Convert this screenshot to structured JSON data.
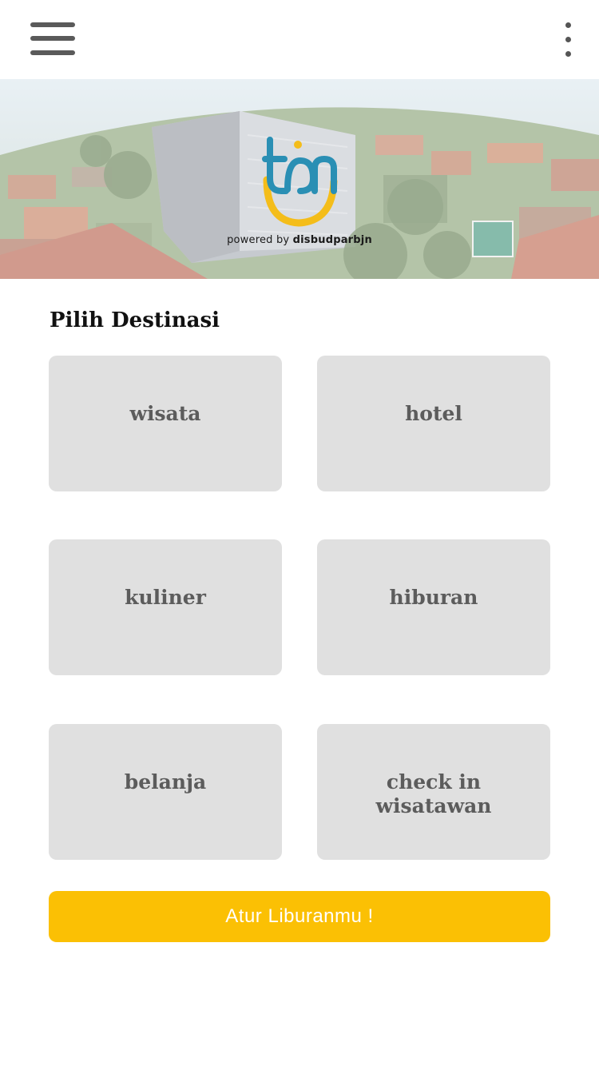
{
  "header": {
    "menu_icon": "hamburger-menu-icon",
    "more_icon": "vertical-dots-icon"
  },
  "banner": {
    "powered_prefix": "powered by",
    "powered_brand": "disbudparbjn",
    "logo_colors": {
      "blue": "#2a8fb4",
      "yellow": "#f4bd1a"
    }
  },
  "main": {
    "section_title": "Pilih Destinasi",
    "categories": [
      {
        "label": "wisata"
      },
      {
        "label": "hotel"
      },
      {
        "label": "kuliner"
      },
      {
        "label": "hiburan"
      },
      {
        "label": "belanja"
      },
      {
        "label": "check in\nwisatawan"
      }
    ],
    "cta_label": "Atur Liburanmu !"
  },
  "colors": {
    "accent": "#fbc004",
    "card_bg": "#e0e0e0",
    "card_text": "#5c5c5c"
  }
}
